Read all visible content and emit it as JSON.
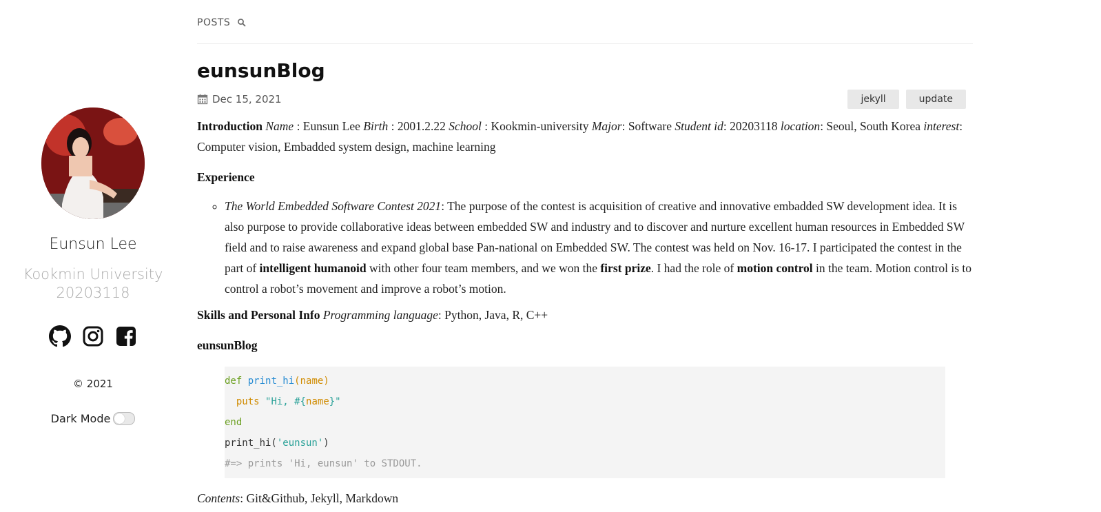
{
  "sidebar": {
    "author_name": "Eunsun Lee",
    "author_bio_line1": "Kookmin University",
    "author_bio_line2": "20203118",
    "social_icons": [
      "github-icon",
      "instagram-icon",
      "facebook-icon"
    ],
    "copyright": "© 2021",
    "dark_mode_label": "Dark Mode",
    "dark_mode_on": false
  },
  "nav": {
    "posts_label": "POSTS",
    "search_icon": "search-icon"
  },
  "post": {
    "title": "eunsunBlog",
    "date": "Dec 15, 2021",
    "tags": [
      "jekyll",
      "update"
    ],
    "intro": {
      "heading": "Introduction",
      "name_label": "Name",
      "name_value": " : Eunsun Lee ",
      "birth_label": "Birth",
      "birth_value": " : 2001.2.22 ",
      "school_label": "School",
      "school_value": " : Kookmin-university ",
      "major_label": "Major",
      "major_value": ": Software ",
      "student_label": "Student id",
      "student_value": ": 20203118 ",
      "location_label": "location",
      "location_value": ": Seoul, South Korea ",
      "interest_label": "interest",
      "interest_value": ": Computer vision, Embadded system design, machine learning"
    },
    "experience": {
      "heading": "Experience",
      "contest_name": "The World Embedded Software Contest 2021",
      "text1": ": The purpose of the contest is acquisition of creative and innovative embadded SW development idea. It is also purpose to provide collaborative ideas between embedded SW and industry and to discover and nurture excellent human resources in Embedded SW field and to raise awareness and expand global base Pan-national on Embedded SW. The contest was held on Nov. 16-17. I participated the contest in the part of ",
      "bold1": "intelligent humanoid",
      "text2": " with other four team members, and we won the ",
      "bold2": "first prize",
      "text3": ". I had the role of ",
      "bold3": "motion control",
      "text4": " in the team. Motion control is to control a robot’s movement and improve a robot’s motion."
    },
    "skills": {
      "heading": "Skills and Personal Info",
      "label": "Programming language",
      "value": ": Python, Java, R, C++"
    },
    "blog_heading": "eunsunBlog",
    "code": {
      "l1_kw": "def",
      "l1_fn": "print_hi",
      "l1_open": "(",
      "l1_param": "name",
      "l1_close": ")",
      "l2_indent": "  ",
      "l2_fn": "puts",
      "l2_sp": " ",
      "l2_str1": "\"Hi, #{",
      "l2_var": "name",
      "l2_str2": "}\"",
      "l3_kw": "end",
      "l4_fn": "print_hi(",
      "l4_str": "'eunsun'",
      "l4_close": ")",
      "l5_comment": "#=> prints 'Hi, eunsun' to STDOUT."
    },
    "contents": {
      "label": "Contents",
      "value": ": Git&Github, Jekyll, Markdown"
    }
  }
}
